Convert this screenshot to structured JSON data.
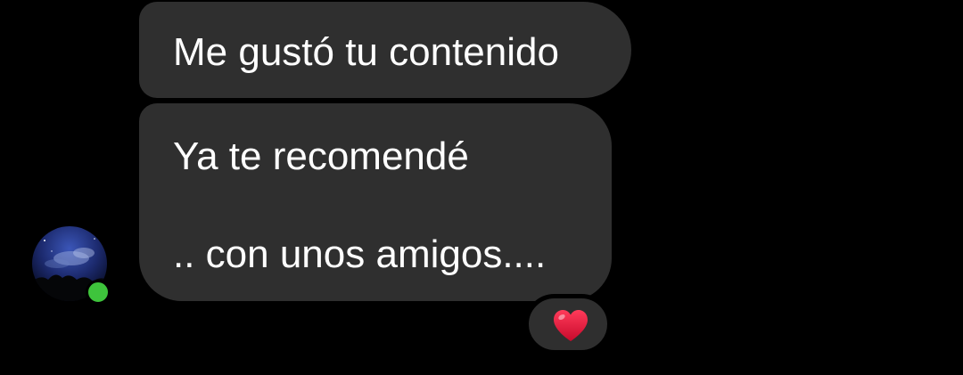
{
  "messages": [
    {
      "lines": [
        "Me gustó tu contenido"
      ]
    },
    {
      "lines": [
        "Ya te recomendé",
        ".. con unos amigos...."
      ]
    }
  ],
  "sender": {
    "avatar": "night-sky-avatar",
    "online": true
  },
  "reaction": {
    "icon": "red-heart-icon",
    "emoji": "❤️",
    "color": "#e8123a"
  },
  "colors": {
    "background": "#000000",
    "bubble": "#2f2f2f",
    "text": "#ffffff",
    "online_dot": "#3ec43c"
  }
}
